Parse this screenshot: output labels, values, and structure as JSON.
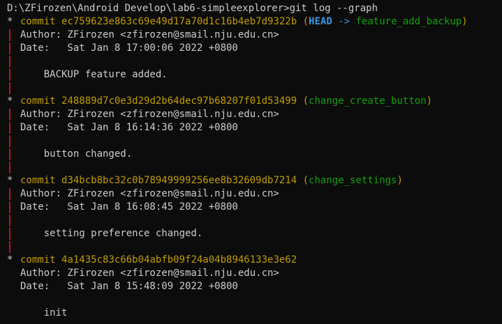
{
  "terminal": {
    "prompt": "D:\\ZFirozen\\Android Develop\\lab6-simpleexplorer>git log --graph",
    "commits": [
      {
        "label": "commit",
        "hash": "ec759623e863c69e49d17a70d1c16b4eb7d9322b",
        "ref_open": "(",
        "head": "HEAD",
        "arrow": "->",
        "branch": "feature_add_backup",
        "ref_close": ")",
        "author": "Author: ZFirozen <zfirozen@smail.nju.edu.cn>",
        "date": "Date:   Sat Jan 8 17:00:06 2022 +0800",
        "message": "    BACKUP feature added."
      },
      {
        "label": "commit",
        "hash": "248889d7c0e3d29d2b64dec97b68207f01d53499",
        "ref_open": "(",
        "branch": "change_create_button",
        "ref_close": ")",
        "author": "Author: ZFirozen <zfirozen@smail.nju.edu.cn>",
        "date": "Date:   Sat Jan 8 16:14:36 2022 +0800",
        "message": "    button changed."
      },
      {
        "label": "commit",
        "hash": "d34bcb8bc32c0b78949999256ee8b32609db7214",
        "ref_open": "(",
        "branch": "change_settings",
        "ref_close": ")",
        "author": "Author: ZFirozen <zfirozen@smail.nju.edu.cn>",
        "date": "Date:   Sat Jan 8 16:08:45 2022 +0800",
        "message": "    setting preference changed."
      },
      {
        "label": "commit",
        "hash": "4a1435c83c66b04abfb09f24a04b8946133e3e62",
        "author": "Author: ZFirozen <zfirozen@smail.nju.edu.cn>",
        "date": "Date:   Sat Jan 8 15:48:09 2022 +0800",
        "message": "    init"
      }
    ],
    "graph_star": "*",
    "colors": {
      "background": "#0c0c0c",
      "text": "#cccccc",
      "commit": "#c19c00",
      "head": "#3a96dd",
      "branch": "#13a10e",
      "graph_bar": "#c50f1f"
    }
  }
}
